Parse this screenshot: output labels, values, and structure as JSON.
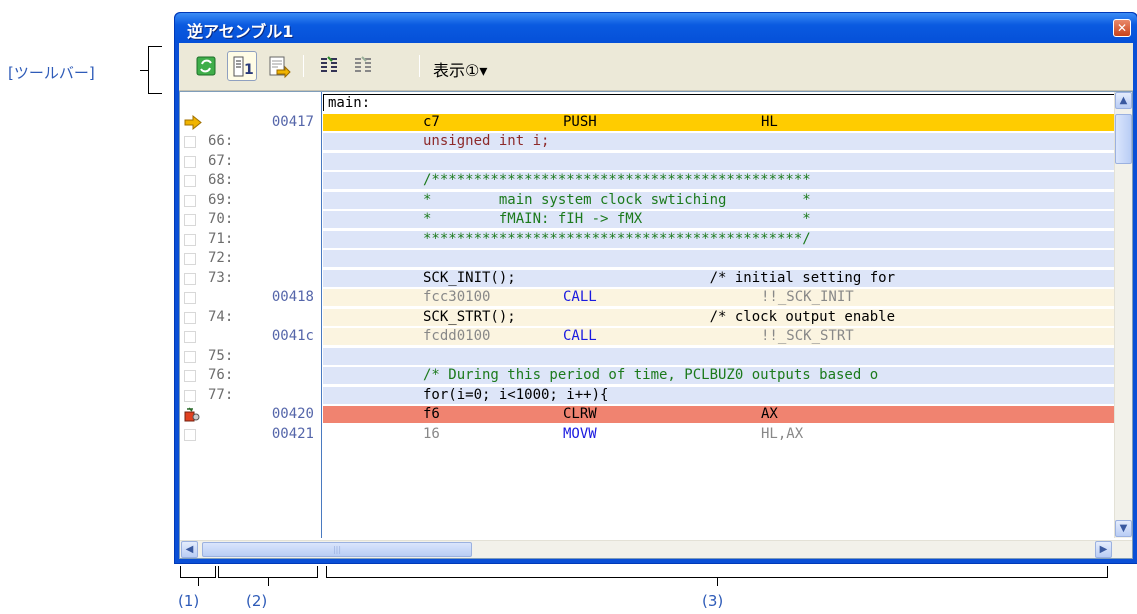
{
  "annotations": {
    "toolbar_label": "[ツールバー]",
    "area1": "(1)",
    "area2": "(2)",
    "area3": "(3)"
  },
  "window": {
    "title": "逆アセンブル1",
    "close_icon": "close-icon"
  },
  "toolbar": {
    "buttons": [
      {
        "name": "refresh-icon",
        "pressed": false
      },
      {
        "name": "mixed-display-icon",
        "pressed": true
      },
      {
        "name": "show-current-pc-icon",
        "pressed": false
      },
      {
        "name": "step-in-icon",
        "pressed": false
      },
      {
        "name": "step-over-icon",
        "pressed": false
      }
    ],
    "view_menu_label": "表示①▾"
  },
  "listing": [
    {
      "mark": "",
      "num": "",
      "kind": "label",
      "code": "main:",
      "bg": "white"
    },
    {
      "mark": "pc-arrow",
      "num": "00417",
      "kind": "asm",
      "op": "c7",
      "mn": "PUSH",
      "arg": "HL",
      "bg": "yellow"
    },
    {
      "mark": "",
      "num": "66:",
      "kind": "src",
      "code": "unsigned int i;",
      "bg": "src"
    },
    {
      "mark": "",
      "num": "67:",
      "kind": "src",
      "code": "",
      "bg": "src"
    },
    {
      "mark": "",
      "num": "68:",
      "kind": "src",
      "code": "/*********************************************",
      "bg": "src"
    },
    {
      "mark": "",
      "num": "69:",
      "kind": "src",
      "code": "*        main system clock swtiching         *",
      "bg": "src"
    },
    {
      "mark": "",
      "num": "70:",
      "kind": "src",
      "code": "*        fMAIN: fIH -> fMX                   *",
      "bg": "src"
    },
    {
      "mark": "",
      "num": "71:",
      "kind": "src",
      "code": "*********************************************/",
      "bg": "src"
    },
    {
      "mark": "",
      "num": "72:",
      "kind": "src",
      "code": "",
      "bg": "src"
    },
    {
      "mark": "",
      "num": "73:",
      "kind": "src",
      "code": "SCK_INIT();                       /* initial setting for",
      "bg": "src"
    },
    {
      "mark": "",
      "num": "00418",
      "kind": "asm",
      "op": "fcc30100",
      "mn": "CALL",
      "arg": "!!_SCK_INIT",
      "bg": "pale"
    },
    {
      "mark": "",
      "num": "74:",
      "kind": "src",
      "code": "SCK_STRT();                       /* clock output enable",
      "bg": "pale"
    },
    {
      "mark": "",
      "num": "0041c",
      "kind": "asm",
      "op": "fcdd0100",
      "mn": "CALL",
      "arg": "!!_SCK_STRT",
      "bg": "pale"
    },
    {
      "mark": "",
      "num": "75:",
      "kind": "src",
      "code": "",
      "bg": "src"
    },
    {
      "mark": "",
      "num": "76:",
      "kind": "src",
      "code": "/* During this period of time, PCLBUZ0 outputs based o",
      "bg": "src"
    },
    {
      "mark": "",
      "num": "77:",
      "kind": "src",
      "code": "for(i=0; i<1000; i++){",
      "bg": "src"
    },
    {
      "mark": "breakpoint",
      "num": "00420",
      "kind": "asm",
      "op": "f6",
      "mn": "CLRW",
      "arg": "AX",
      "bg": "red"
    },
    {
      "mark": "",
      "num": "00421",
      "kind": "asm",
      "op": "16",
      "mn": "MOVW",
      "arg": "HL,AX",
      "bg": "white"
    }
  ],
  "scrollbar": {
    "up_icon": "scroll-up-icon",
    "down_icon": "scroll-down-icon",
    "left_icon": "scroll-left-icon",
    "right_icon": "scroll-right-icon"
  }
}
